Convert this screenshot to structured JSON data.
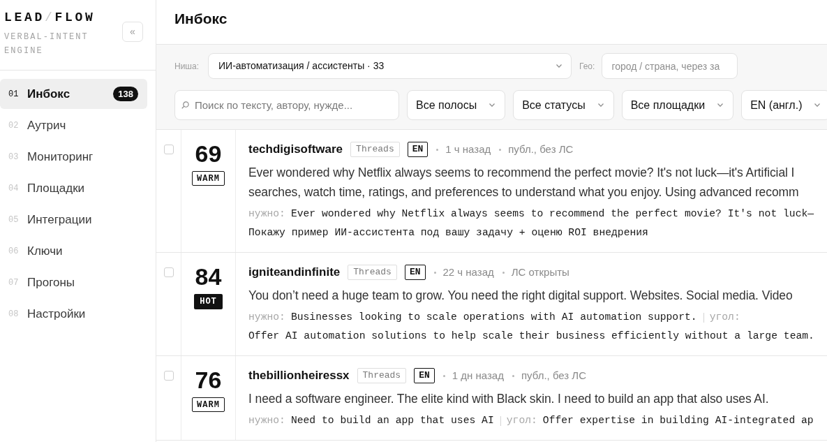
{
  "sidebar": {
    "logo": [
      {
        "text": "LEAD",
        "muted": false
      },
      {
        "text": "/",
        "muted": true
      },
      {
        "text": "FLOW",
        "muted": false
      }
    ],
    "tagline": "VERBAL-INTENT ENGINE",
    "collapse_button": "«",
    "nav": [
      {
        "number": "01",
        "label": "Инбокс",
        "count": "138",
        "selected": true
      },
      {
        "number": "02",
        "label": "Аутрич",
        "selected": false
      },
      {
        "number": "03",
        "label": "Мониторинг",
        "selected": false
      },
      {
        "number": "04",
        "label": "Площадки",
        "selected": false
      },
      {
        "number": "05",
        "label": "Интеграции",
        "selected": false
      },
      {
        "number": "06",
        "label": "Ключи",
        "selected": false
      },
      {
        "number": "07",
        "label": "Прогоны",
        "selected": false
      },
      {
        "number": "08",
        "label": "Настройки",
        "selected": false
      }
    ]
  },
  "page_title": "Инбокс",
  "filters": {
    "niche": {
      "label": "Ниша:",
      "value": "ИИ-автоматизация / ассистенты · 33"
    },
    "geo": {
      "label": "Гео:",
      "placeholder": "город / страна, через за"
    },
    "search": {
      "placeholder": "Поиск по тексту, автору, нужде..."
    },
    "selects": [
      "Все полосы",
      "Все статусы",
      "Все площадки",
      "EN (англ.)"
    ]
  },
  "rows": [
    {
      "checked": false,
      "score": "69",
      "badge": {
        "text": "WARM",
        "filled": false
      },
      "author": "techdigisoftware",
      "platform": "Threads",
      "language": "EN",
      "meta": [
        "1 ч назад",
        "публ., без ЛС"
      ],
      "body_lines": [
        "Ever wondered why Netflix always seems to recommend the perfect movie? It's not luck—it's Artificial I",
        "searches, watch time, ratings, and preferences to understand what you enjoy. Using advanced recomm"
      ],
      "notes": [
        [
          {
            "kind": "label",
            "text": "нужно:"
          },
          {
            "kind": "value",
            "text": "Ever wondered why Netflix always seems to recommend the perfect movie? It's not luck—"
          }
        ],
        [
          {
            "kind": "value",
            "text": "Покажу пример ИИ-ассистента под вашу задачу + оценю ROI внедрения"
          }
        ]
      ]
    },
    {
      "checked": false,
      "score": "84",
      "badge": {
        "text": "HOT",
        "filled": true
      },
      "author": "igniteandinfinite",
      "platform": "Threads",
      "language": "EN",
      "meta": [
        "22 ч назад",
        "ЛС открыты"
      ],
      "body_lines": [
        "You don’t need a huge team to grow. You need the right digital support. Websites. Social media. Video"
      ],
      "notes": [
        [
          {
            "kind": "label",
            "text": "нужно:"
          },
          {
            "kind": "value",
            "text": "Businesses looking to scale operations with AI automation support."
          },
          {
            "kind": "divider"
          },
          {
            "kind": "label",
            "text": "угол:"
          }
        ],
        [
          {
            "kind": "value",
            "text": "Offer AI automation solutions to help scale their business efficiently without a large team."
          }
        ]
      ]
    },
    {
      "checked": false,
      "score": "76",
      "badge": {
        "text": "WARM",
        "filled": false
      },
      "author": "thebillionheiressx",
      "platform": "Threads",
      "language": "EN",
      "meta": [
        "1 дн назад",
        "публ., без ЛС"
      ],
      "body_lines": [
        "I need a software engineer. The elite kind with Black skin. I need to build an app that also uses AI."
      ],
      "notes": [
        [
          {
            "kind": "label",
            "text": "нужно:"
          },
          {
            "kind": "value",
            "text": "Need to build an app that uses AI"
          },
          {
            "kind": "divider"
          },
          {
            "kind": "label",
            "text": "угол:"
          },
          {
            "kind": "value",
            "text": "Offer expertise in building AI-integrated ap"
          }
        ]
      ]
    }
  ]
}
